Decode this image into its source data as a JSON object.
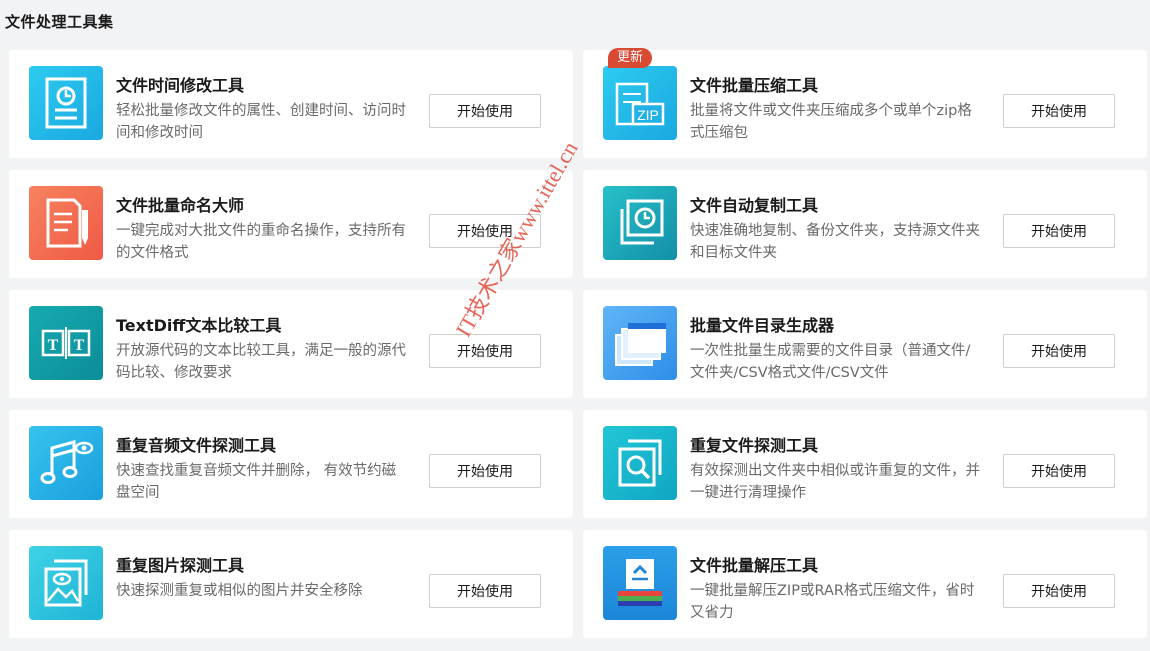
{
  "page_title": "文件处理工具集",
  "colors": {
    "page_bg": "#f2f3f5",
    "card_bg": "#ffffff",
    "badge_bg": "#d94a35"
  },
  "tools": [
    {
      "title": "文件时间修改工具",
      "desc": "轻松批量修改文件的属性、创建时间、访问时间和修改时间",
      "button": "开始使用",
      "icon": "file-clock-icon",
      "color": "#22b5e6"
    },
    {
      "title": "文件批量压缩工具",
      "desc": "批量将文件或文件夹压缩成多个或单个zip格式压缩包",
      "button": "开始使用",
      "icon": "zip-icon",
      "color": "#1fb3e3",
      "badge": "更新"
    },
    {
      "title": "文件批量命名大师",
      "desc": "一键完成对大批文件的重命名操作，支持所有的文件格式",
      "button": "开始使用",
      "icon": "rename-icon",
      "color": "#f26b4e"
    },
    {
      "title": "文件自动复制工具",
      "desc": "快速准确地复制、备份文件夹，支持源文件夹和目标文件夹",
      "button": "开始使用",
      "icon": "copy-clock-icon",
      "color": "#1aa9b8"
    },
    {
      "title": "TextDiff文本比较工具",
      "desc": "开放源代码的文本比较工具，满足一般的源代码比较、修改要求",
      "button": "开始使用",
      "icon": "textdiff-icon",
      "color": "#14a0a8"
    },
    {
      "title": "批量文件目录生成器",
      "desc": "一次性批量生成需要的文件目录（普通文件/文件夹/CSV格式文件/CSV文件",
      "button": "开始使用",
      "icon": "folders-icon",
      "color": "#3d9cf0"
    },
    {
      "title": "重复音频文件探测工具",
      "desc": "快速查找重复音频文件并删除， 有效节约磁盘空间",
      "button": "开始使用",
      "icon": "music-eye-icon",
      "color": "#25b4e6"
    },
    {
      "title": "重复文件探测工具",
      "desc": "有效探测出文件夹中相似或许重复的文件，并一键进行清理操作",
      "button": "开始使用",
      "icon": "file-search-icon",
      "color": "#19b6cf"
    },
    {
      "title": "重复图片探测工具",
      "desc": "快速探测重复或相似的图片并安全移除",
      "button": "开始使用",
      "icon": "image-eye-icon",
      "color": "#2ac4dc"
    },
    {
      "title": "文件批量解压工具",
      "desc": "一键批量解压ZIP或RAR格式压缩文件，省时又省力",
      "button": "开始使用",
      "icon": "unzip-icon",
      "color": "#1f8fe0"
    }
  ],
  "watermark": "IT技术之家www.ittel.cn"
}
